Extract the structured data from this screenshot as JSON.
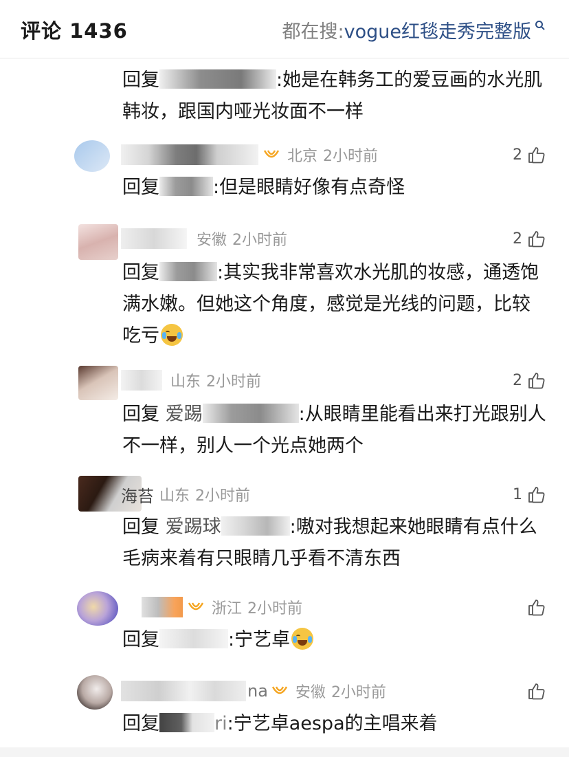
{
  "header": {
    "title": "评论 1436",
    "search_prefix": "都在搜:",
    "search_term": "vogue红毯走秀完整版"
  },
  "first_reply": {
    "prefix": "回复",
    "text": ":她是在韩务工的爱豆画的水光肌韩妆，跟国内哑光妆面不一样"
  },
  "comments": [
    {
      "name_visible": "",
      "location": "北京",
      "time": "2小时前",
      "likes": "2",
      "vip": true,
      "reply_prefix": "回复",
      "reply_user": "",
      "reply_text": ":但是眼睛好像有点奇怪",
      "emoji": false
    },
    {
      "name_visible": "",
      "location": "安徽",
      "time": "2小时前",
      "likes": "2",
      "vip": false,
      "reply_prefix": "回复",
      "reply_user": "",
      "reply_text": ":其实我非常喜欢水光肌的妆感，通透饱满水嫩。但她这个角度，感觉是光线的问题，比较吃亏",
      "emoji": true
    },
    {
      "name_visible": "",
      "location": "山东",
      "time": "2小时前",
      "likes": "2",
      "vip": false,
      "reply_prefix": "回复",
      "reply_user": "爱踢",
      "reply_text": ":从眼睛里能看出来打光跟别人不一样，别人一个光点她两个",
      "emoji": false
    },
    {
      "name_visible": "海苔",
      "location": "山东",
      "time": "2小时前",
      "likes": "1",
      "vip": false,
      "reply_prefix": "回复",
      "reply_user": "爱踢球",
      "reply_text": ":嗷对我想起来她眼睛有点什么毛病来着有只眼睛几乎看不清东西",
      "emoji": false
    },
    {
      "name_visible": "",
      "location": "浙江",
      "time": "2小时前",
      "likes": "",
      "vip": true,
      "reply_prefix": "回复",
      "reply_user": "",
      "reply_text": ":宁艺卓",
      "emoji": true
    },
    {
      "name_visible": "na",
      "location": "安徽",
      "time": "2小时前",
      "likes": "",
      "vip": true,
      "reply_prefix": "回复",
      "reply_user": "ri",
      "reply_text": ":宁艺卓aespa的主唱来着",
      "emoji": false
    }
  ],
  "icons": {
    "search": "search-icon",
    "like": "thumbs-up-icon",
    "vip": "vip-badge-icon",
    "emoji": "crying-laughing-emoji"
  },
  "colors": {
    "search_term": "#2d4f86",
    "meta_gray": "#999999",
    "vip_orange": "#f5a623"
  }
}
